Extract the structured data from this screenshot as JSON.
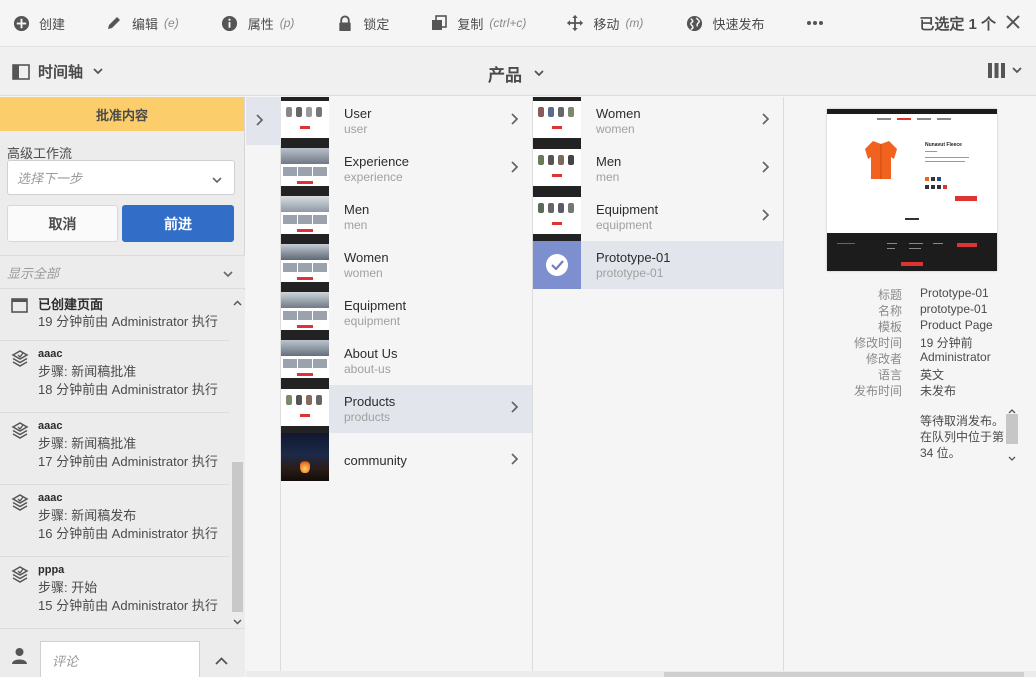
{
  "toolbar": {
    "create": {
      "label": "创建",
      "icon": "add-circle-icon"
    },
    "edit": {
      "label": "编辑",
      "shortcut": "(e)",
      "icon": "pencil-icon"
    },
    "properties": {
      "label": "属性",
      "shortcut": "(p)",
      "icon": "info-icon"
    },
    "lock": {
      "label": "锁定",
      "icon": "lock-icon"
    },
    "copy": {
      "label": "复制",
      "shortcut": "(ctrl+c)",
      "icon": "copy-icon"
    },
    "move": {
      "label": "移动",
      "shortcut": "(m)",
      "icon": "move-icon"
    },
    "quick_publish": {
      "label": "快速发布",
      "icon": "globe-icon"
    },
    "more_icon": "more-icon",
    "selection": "已选定 1 个",
    "close_icon": "close-icon"
  },
  "navbar": {
    "rail_label": "时间轴",
    "breadcrumb": "产品"
  },
  "rail": {
    "approve_title": "批准内容",
    "workflow_label": "高级工作流",
    "workflow_placeholder": "选择下一步",
    "cancel_label": "取消",
    "advance_label": "前进",
    "filter_label": "显示全部",
    "timeline": [
      {
        "title": "已创建页面",
        "detail": "19 分钟前由 Administrator 执行",
        "icon": "page-icon"
      },
      {
        "title": "aaac",
        "step": "步骤: 新闻稿批准",
        "detail": "18 分钟前由 Administrator 执行",
        "icon": "workflow-icon"
      },
      {
        "title": "aaac",
        "step": "步骤: 新闻稿批准",
        "detail": "17 分钟前由 Administrator 执行",
        "icon": "workflow-icon"
      },
      {
        "title": "aaac",
        "step": "步骤: 新闻稿发布",
        "detail": "16 分钟前由 Administrator 执行",
        "icon": "workflow-icon"
      },
      {
        "title": "pppa",
        "step": "步骤: 开始",
        "detail": "15 分钟前由 Administrator 执行",
        "icon": "workflow-icon"
      }
    ],
    "comment_placeholder": "评论"
  },
  "columns": {
    "col1": [
      {
        "title": "User",
        "name": "user"
      },
      {
        "title": "Experience",
        "name": "experience"
      },
      {
        "title": "Men",
        "name": "men"
      },
      {
        "title": "Women",
        "name": "women"
      },
      {
        "title": "Equipment",
        "name": "equipment"
      },
      {
        "title": "About Us",
        "name": "about-us"
      },
      {
        "title": "Products",
        "name": "products"
      },
      {
        "title": "community",
        "name": ""
      }
    ],
    "col2": [
      {
        "title": "Women",
        "name": "women"
      },
      {
        "title": "Men",
        "name": "men"
      },
      {
        "title": "Equipment",
        "name": "equipment"
      },
      {
        "title": "Prototype-01",
        "name": "prototype-01"
      }
    ]
  },
  "preview": {
    "product_title": "Nunavut Fleece",
    "meta": [
      {
        "key": "标题",
        "value": "Prototype-01"
      },
      {
        "key": "名称",
        "value": "prototype-01"
      },
      {
        "key": "模板",
        "value": "Product Page"
      },
      {
        "key": "修改时间",
        "value": "19 分钟前"
      },
      {
        "key": "修改者",
        "value": "Administrator"
      },
      {
        "key": "语言",
        "value": "英文"
      },
      {
        "key": "发布时间",
        "value": "未发布"
      }
    ],
    "status_lines": [
      "等待取消发布。",
      "在队列中位于第",
      "34 位。"
    ]
  },
  "colors": {
    "accent": "#326ec8",
    "banner": "#fbcd6b",
    "selected_row": "#e2e6ec"
  }
}
